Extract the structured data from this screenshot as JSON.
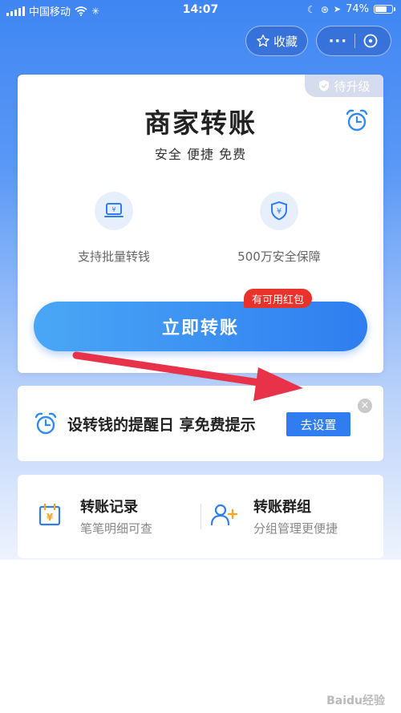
{
  "status_bar": {
    "carrier": "中国移动",
    "time": "14:07",
    "battery": "74%",
    "battery_level": 0.74
  },
  "nav": {
    "favorite_label": "收藏",
    "more_label": "···"
  },
  "main_card": {
    "upgrade_badge": "待升级",
    "title": "商家转账",
    "subtitle": "安全 便捷 免费",
    "features": [
      {
        "label": "支持批量转钱",
        "icon": "transfer-screen-icon"
      },
      {
        "label": "500万安全保障",
        "icon": "shield-yuan-icon"
      }
    ],
    "redpack_badge": "有可用红包",
    "transfer_button": "立即转账"
  },
  "reminder_card": {
    "text": "设转钱的提醒日 享免费提示",
    "button": "去设置"
  },
  "links": [
    {
      "title": "转账记录",
      "subtitle": "笔笔明细可查",
      "icon": "calendar-yuan-icon"
    },
    {
      "title": "转账群组",
      "subtitle": "分组管理更便捷",
      "icon": "user-add-icon"
    }
  ],
  "watermark": "Baidu经验",
  "colors": {
    "primary": "#2f7df0",
    "badge_red": "#e8322a",
    "annotation_arrow": "#e8324a"
  }
}
